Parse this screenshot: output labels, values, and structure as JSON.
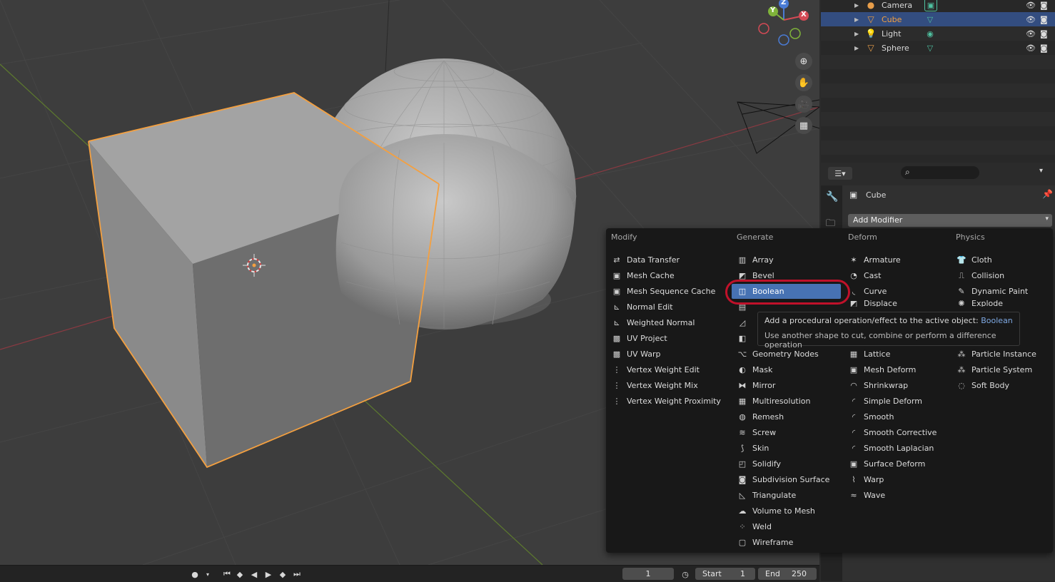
{
  "outliner": {
    "rows": [
      {
        "label": "Camera",
        "icon": "camera-object-icon",
        "data_icon": "camera-data-icon"
      },
      {
        "label": "Cube",
        "icon": "mesh-object-icon",
        "data_icon": "mesh-data-icon",
        "selected": true
      },
      {
        "label": "Light",
        "icon": "light-object-icon",
        "data_icon": "light-data-icon"
      },
      {
        "label": "Sphere",
        "icon": "mesh-object-icon",
        "data_icon": "mesh-data-icon"
      }
    ]
  },
  "properties": {
    "object_name": "Cube",
    "add_modifier_label": "Add Modifier"
  },
  "modifier_menu": {
    "columns": [
      {
        "header": "Modify",
        "items": [
          "Data Transfer",
          "Mesh Cache",
          "Mesh Sequence Cache",
          "Normal Edit",
          "Weighted Normal",
          "UV Project",
          "UV Warp",
          "Vertex Weight Edit",
          "Vertex Weight Mix",
          "Vertex Weight Proximity"
        ]
      },
      {
        "header": "Generate",
        "items": [
          "Array",
          "Bevel",
          "Boolean",
          "",
          "",
          "",
          "Geometry Nodes",
          "Mask",
          "Mirror",
          "Multiresolution",
          "Remesh",
          "Screw",
          "Skin",
          "Solidify",
          "Subdivision Surface",
          "Triangulate",
          "Volume to Mesh",
          "Weld",
          "Wireframe"
        ]
      },
      {
        "header": "Deform",
        "items": [
          "Armature",
          "Cast",
          "Curve",
          "Displace",
          "",
          "",
          "Lattice",
          "Mesh Deform",
          "Shrinkwrap",
          "Simple Deform",
          "Smooth",
          "Smooth Corrective",
          "Smooth Laplacian",
          "Surface Deform",
          "Warp",
          "Wave"
        ]
      },
      {
        "header": "Physics",
        "items": [
          "Cloth",
          "Collision",
          "Dynamic Paint",
          "Explode",
          "",
          "",
          "Particle Instance",
          "Particle System",
          "Soft Body"
        ]
      }
    ],
    "highlighted": "Boolean"
  },
  "tooltip": {
    "line1_prefix": "Add a procedural operation/effect to the active object:",
    "line1_value": "Boolean",
    "line2": "Use another shape to cut, combine or perform a difference operation"
  },
  "timeline": {
    "current_frame": "1",
    "start_label": "Start",
    "start_value": "1",
    "end_label": "End",
    "end_value": "250"
  },
  "gizmo": {
    "x": "X",
    "y": "Y",
    "z": "Z"
  },
  "colors": {
    "accent": "#4772b3",
    "selection_outline": "#f4a040",
    "ring": "#c0112a"
  }
}
